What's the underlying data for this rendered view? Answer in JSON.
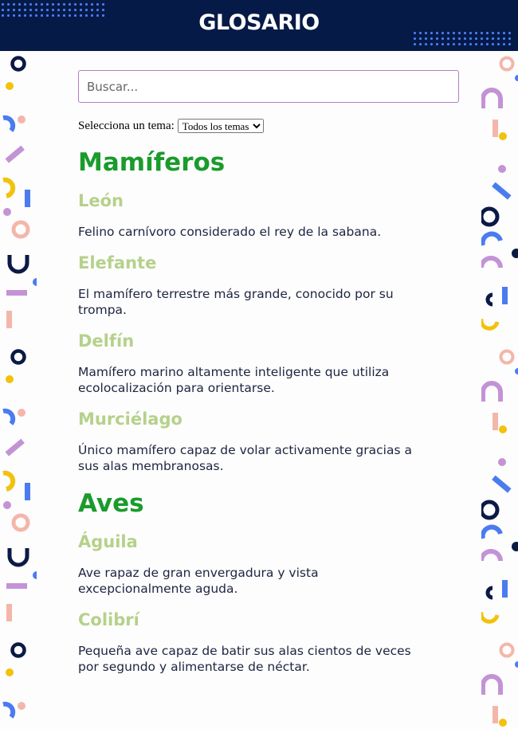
{
  "header": {
    "title": "GLOSARIO"
  },
  "search": {
    "placeholder": "Buscar..."
  },
  "topic_filter": {
    "label": "Selecciona un tema:",
    "selected": "Todos los temas"
  },
  "categories": [
    {
      "title": "Mamíferos",
      "terms": [
        {
          "name": "León",
          "definition": "Felino carnívoro considerado el rey de la sabana."
        },
        {
          "name": "Elefante",
          "definition": "El mamífero terrestre más grande, conocido por su trompa."
        },
        {
          "name": "Delfín",
          "definition": "Mamífero marino altamente inteligente que utiliza ecolocalización para orientarse."
        },
        {
          "name": "Murciélago",
          "definition": "Único mamífero capaz de volar activamente gracias a sus alas membranosas."
        }
      ]
    },
    {
      "title": "Aves",
      "terms": [
        {
          "name": "Águila",
          "definition": "Ave rapaz de gran envergadura y vista excepcionalmente aguda."
        },
        {
          "name": "Colibrí",
          "definition": "Pequeña ave capaz de batir sus alas cientos de veces por segundo y alimentarse de néctar."
        }
      ]
    }
  ],
  "colors": {
    "header_bg": "#061a47",
    "category": "#1a9b2c",
    "term": "#b5d18b",
    "text": "#1d2440",
    "confetti_navy": "#0b1a45",
    "confetti_blue": "#4a7cf0",
    "confetti_purple": "#c393d6",
    "confetti_pink": "#f4b6aa",
    "confetti_yellow": "#f2c20c"
  }
}
